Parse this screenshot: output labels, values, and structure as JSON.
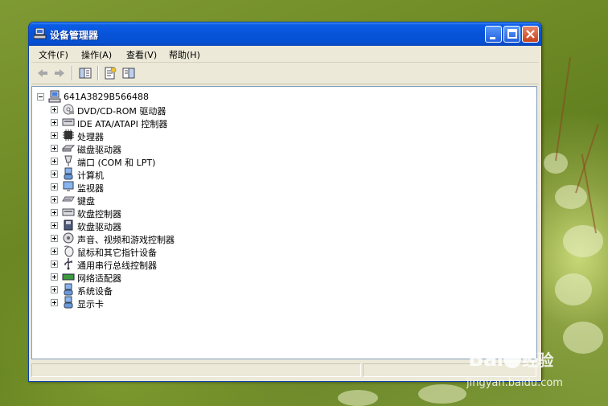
{
  "window": {
    "title": "设备管理器"
  },
  "menubar": {
    "items": [
      "文件(F)",
      "操作(A)",
      "查看(V)",
      "帮助(H)"
    ]
  },
  "tree": {
    "root": "641A3829B566488",
    "items": [
      {
        "label": "DVD/CD-ROM 驱动器",
        "icon": "cdrom-icon"
      },
      {
        "label": "IDE ATA/ATAPI 控制器",
        "icon": "ide-controller-icon"
      },
      {
        "label": "处理器",
        "icon": "processor-icon"
      },
      {
        "label": "磁盘驱动器",
        "icon": "disk-drive-icon"
      },
      {
        "label": "端口 (COM 和 LPT)",
        "icon": "port-icon"
      },
      {
        "label": "计算机",
        "icon": "computer-icon"
      },
      {
        "label": "监视器",
        "icon": "monitor-icon"
      },
      {
        "label": "键盘",
        "icon": "keyboard-icon"
      },
      {
        "label": "软盘控制器",
        "icon": "floppy-controller-icon"
      },
      {
        "label": "软盘驱动器",
        "icon": "floppy-drive-icon"
      },
      {
        "label": "声音、视频和游戏控制器",
        "icon": "sound-icon"
      },
      {
        "label": "鼠标和其它指针设备",
        "icon": "mouse-icon"
      },
      {
        "label": "通用串行总线控制器",
        "icon": "usb-icon"
      },
      {
        "label": "网络适配器",
        "icon": "network-adapter-icon"
      },
      {
        "label": "系统设备",
        "icon": "system-device-icon"
      },
      {
        "label": "显示卡",
        "icon": "display-adapter-icon"
      }
    ]
  },
  "watermark": {
    "brand": "Bai",
    "brand_tail": "经验",
    "url": "jingyan.baidu.com"
  },
  "colors": {
    "titlebar": "#0753d8",
    "window_bg": "#ece9d8",
    "close_button": "#c9401c"
  }
}
